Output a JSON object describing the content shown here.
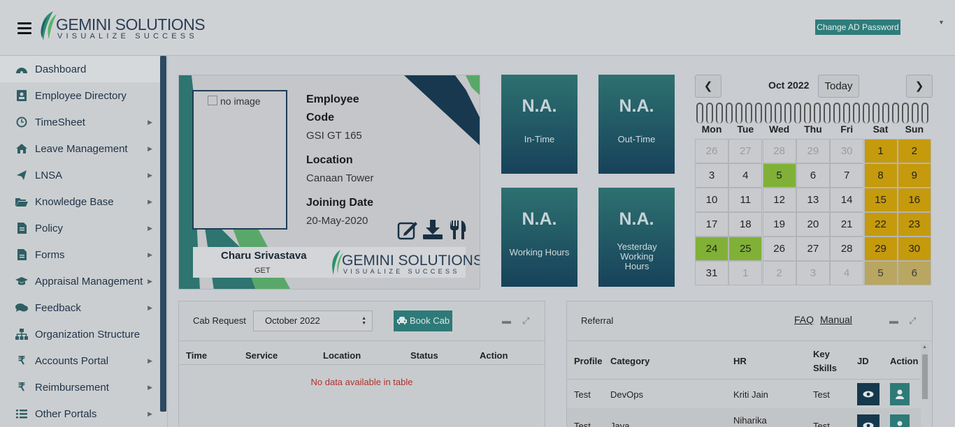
{
  "header": {
    "logo_name": "GEMINI SOLUTIONS",
    "logo_tagline": "VISUALIZE SUCCESS",
    "change_password_label": "Change AD Password",
    "user_menu_caret": "▼"
  },
  "sidebar": {
    "items": [
      {
        "label": "Dashboard",
        "icon": "dashboard-icon",
        "submenu": false
      },
      {
        "label": "Employee Directory",
        "icon": "id-card-icon",
        "submenu": false
      },
      {
        "label": "TimeSheet",
        "icon": "clock-icon",
        "submenu": true
      },
      {
        "label": "Leave Management",
        "icon": "home-icon",
        "submenu": true
      },
      {
        "label": "LNSA",
        "icon": "paper-plane-icon",
        "submenu": true
      },
      {
        "label": "Knowledge Base",
        "icon": "folder-open-icon",
        "submenu": true
      },
      {
        "label": "Policy",
        "icon": "document-icon",
        "submenu": true
      },
      {
        "label": "Forms",
        "icon": "file-icon",
        "submenu": true
      },
      {
        "label": "Appraisal Management",
        "icon": "graduation-cap-icon",
        "submenu": true
      },
      {
        "label": "Feedback",
        "icon": "comments-icon",
        "submenu": true
      },
      {
        "label": "Organization Structure",
        "icon": "sitemap-icon",
        "submenu": false
      },
      {
        "label": "Accounts Portal",
        "icon": "rupee-icon",
        "submenu": true
      },
      {
        "label": "Reimbursement",
        "icon": "rupee-icon",
        "submenu": true
      },
      {
        "label": "Other Portals",
        "icon": "list-icon",
        "submenu": true
      }
    ]
  },
  "profile": {
    "photo_alt": "no image",
    "employee_code_label": "Employee Code",
    "employee_code": "GSI GT 165",
    "location_label": "Location",
    "location": "Canaan Tower",
    "joining_label": "Joining Date",
    "joining_date": "20-May-2020",
    "name": "Charu Srivastava",
    "org": "GET"
  },
  "tiles": [
    {
      "value": "N.A.",
      "label": "In-Time"
    },
    {
      "value": "N.A.",
      "label": "Out-Time"
    },
    {
      "value": "N.A.",
      "label": "Working Hours"
    },
    {
      "value": "N.A.",
      "label": "Yesterday Working Hours"
    }
  ],
  "calendar": {
    "month": "Oct 2022",
    "today_label": "Today",
    "prev": "❮",
    "next": "❯",
    "weekdays": [
      "Mon",
      "Tue",
      "Wed",
      "Thu",
      "Fri",
      "Sat",
      "Sun"
    ],
    "weeks": [
      [
        [
          "26",
          "o"
        ],
        [
          "27",
          "o"
        ],
        [
          "28",
          "o"
        ],
        [
          "29",
          "o"
        ],
        [
          "30",
          "o"
        ],
        [
          "1",
          "w"
        ],
        [
          "2",
          "w"
        ]
      ],
      [
        [
          "3",
          ""
        ],
        [
          "4",
          ""
        ],
        [
          "5",
          "g"
        ],
        [
          "6",
          ""
        ],
        [
          "7",
          ""
        ],
        [
          "8",
          "w"
        ],
        [
          "9",
          "w"
        ]
      ],
      [
        [
          "10",
          ""
        ],
        [
          "11",
          ""
        ],
        [
          "12",
          ""
        ],
        [
          "13",
          ""
        ],
        [
          "14",
          ""
        ],
        [
          "15",
          "w"
        ],
        [
          "16",
          "w"
        ]
      ],
      [
        [
          "17",
          ""
        ],
        [
          "18",
          ""
        ],
        [
          "19",
          ""
        ],
        [
          "20",
          ""
        ],
        [
          "21",
          ""
        ],
        [
          "22",
          "w"
        ],
        [
          "23",
          "w"
        ]
      ],
      [
        [
          "24",
          "g"
        ],
        [
          "25",
          "g"
        ],
        [
          "26",
          ""
        ],
        [
          "27",
          ""
        ],
        [
          "28",
          ""
        ],
        [
          "29",
          "w"
        ],
        [
          "30",
          "w"
        ]
      ],
      [
        [
          "31",
          ""
        ],
        [
          "1",
          "o"
        ],
        [
          "2",
          "o"
        ],
        [
          "3",
          "o"
        ],
        [
          "4",
          "o"
        ],
        [
          "5",
          "wo"
        ],
        [
          "6",
          "wo"
        ]
      ]
    ]
  },
  "cab": {
    "title": "Cab Request",
    "month_select": "October 2022",
    "book_label": "Book Cab",
    "columns": [
      "Time",
      "Service",
      "Location",
      "Status",
      "Action"
    ],
    "empty_message": "No data available in table"
  },
  "referral": {
    "title": "Referral",
    "faq_label": "FAQ",
    "manual_label": "Manual",
    "columns": [
      "Profile",
      "Category",
      "HR",
      "Key Skills",
      "JD",
      "Action"
    ],
    "rows": [
      {
        "profile": "Test",
        "category": "DevOps",
        "hr": "Kriti Jain",
        "skills": "Test"
      },
      {
        "profile": "Test",
        "category": "Java",
        "hr": "Niharika",
        "skills": "Test"
      }
    ]
  },
  "colors": {
    "accent_teal": "#2e7a78",
    "navy": "#15384d",
    "weekend": "#c59a0c",
    "present": "#80b136"
  }
}
